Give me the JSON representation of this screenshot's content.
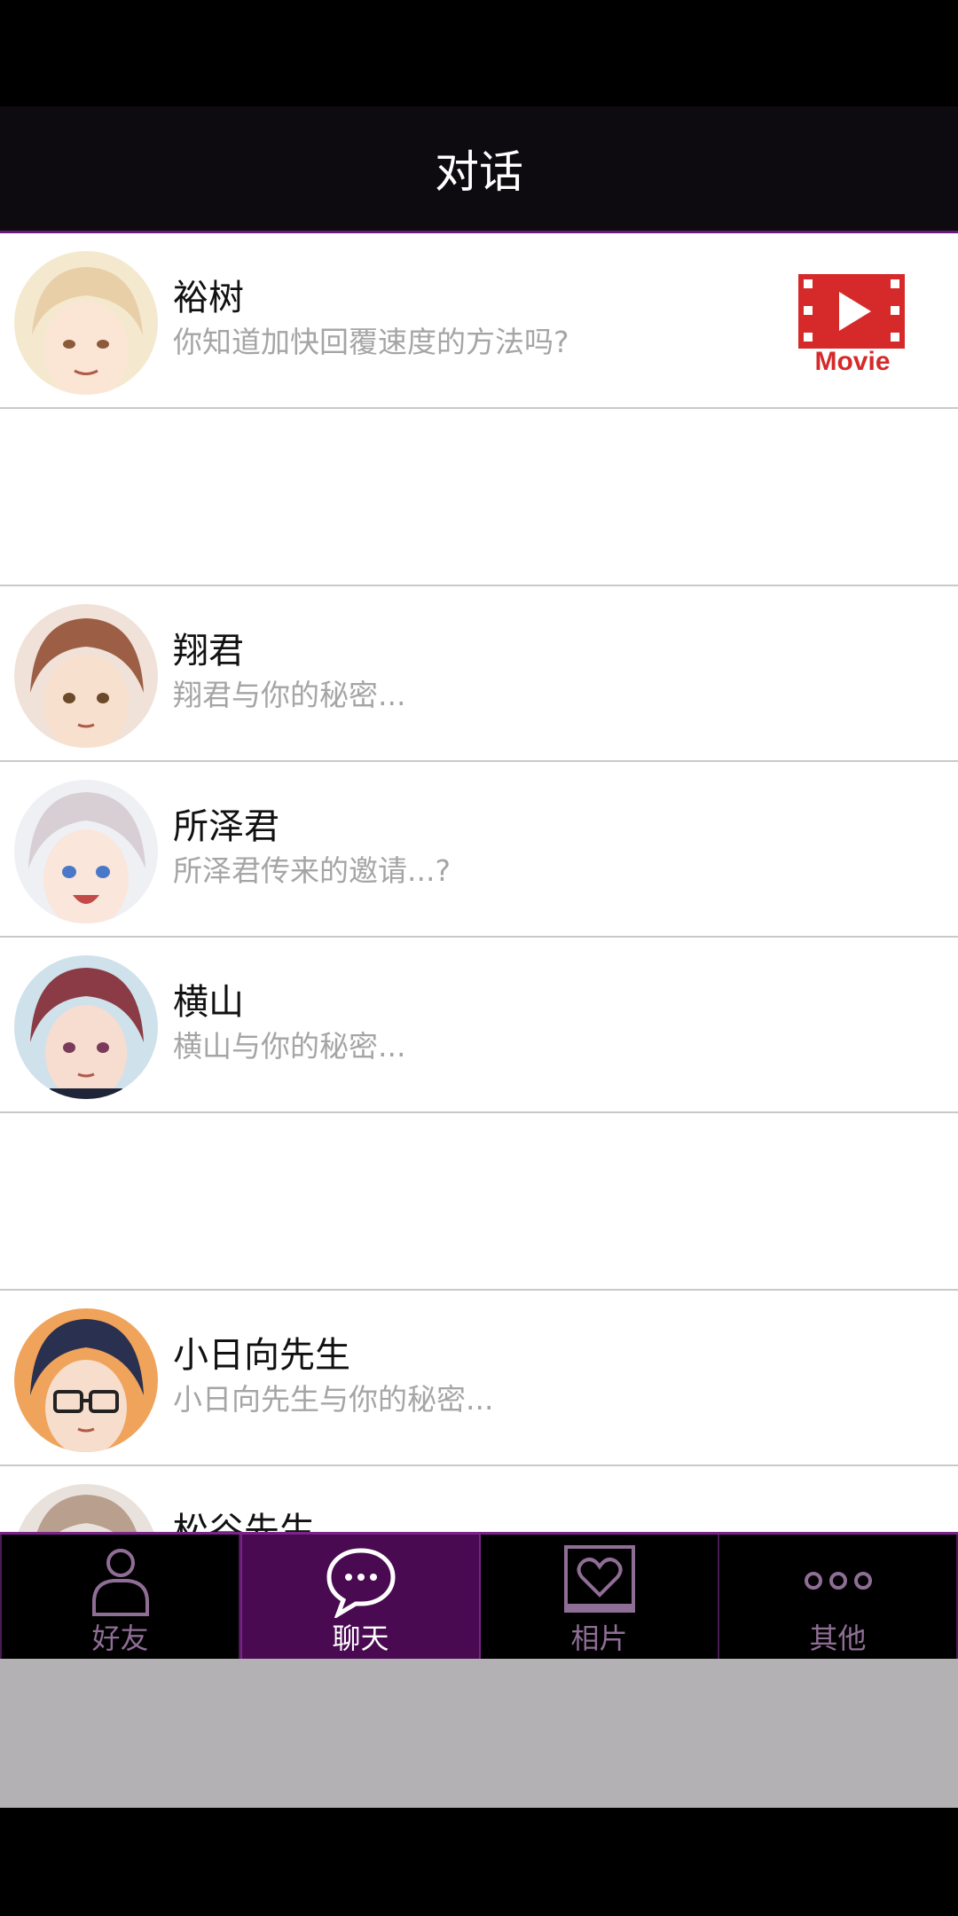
{
  "header": {
    "title": "对话"
  },
  "movie": {
    "label": "Movie",
    "color": "#d62a2a"
  },
  "chats": [
    {
      "name": "裕树",
      "preview": "你知道加快回覆速度的方法吗?",
      "hair": "#e8cfa8",
      "skin": "#fbe6d6",
      "bg": "#f4e9cf"
    },
    {
      "name": "翔君",
      "preview": "翔君与你的秘密...",
      "hair": "#9c5f46",
      "skin": "#f8e0cf",
      "bg": "#f0e2d8"
    },
    {
      "name": "所泽君",
      "preview": "所泽君传来的邀请...?",
      "hair": "#d8cfd4",
      "skin": "#fae6da",
      "bg": "#eef0f4"
    },
    {
      "name": "横山",
      "preview": "横山与你的秘密...",
      "hair": "#8a3b45",
      "skin": "#f6ddd0",
      "bg": "#cfe1ea"
    },
    {
      "name": "小日向先生",
      "preview": "小日向先生与你的秘密...",
      "hair": "#2a3050",
      "skin": "#f6ddcc",
      "bg": "#f0a35a"
    },
    {
      "name": "松谷先生",
      "preview": "",
      "hair": "#b99f8d",
      "skin": "#f3dccd",
      "bg": "#e9e2dc"
    }
  ],
  "tabs": [
    {
      "label": "好友",
      "icon": "person-icon",
      "active": false
    },
    {
      "label": "聊天",
      "icon": "chat-bubble-icon",
      "active": true
    },
    {
      "label": "相片",
      "icon": "heart-photo-icon",
      "active": false
    },
    {
      "label": "其他",
      "icon": "more-dots-icon",
      "active": false
    }
  ],
  "colors": {
    "accent": "#7b2389",
    "active_tab": "#4a0a52",
    "tab_inactive_text": "#8f6e96"
  }
}
